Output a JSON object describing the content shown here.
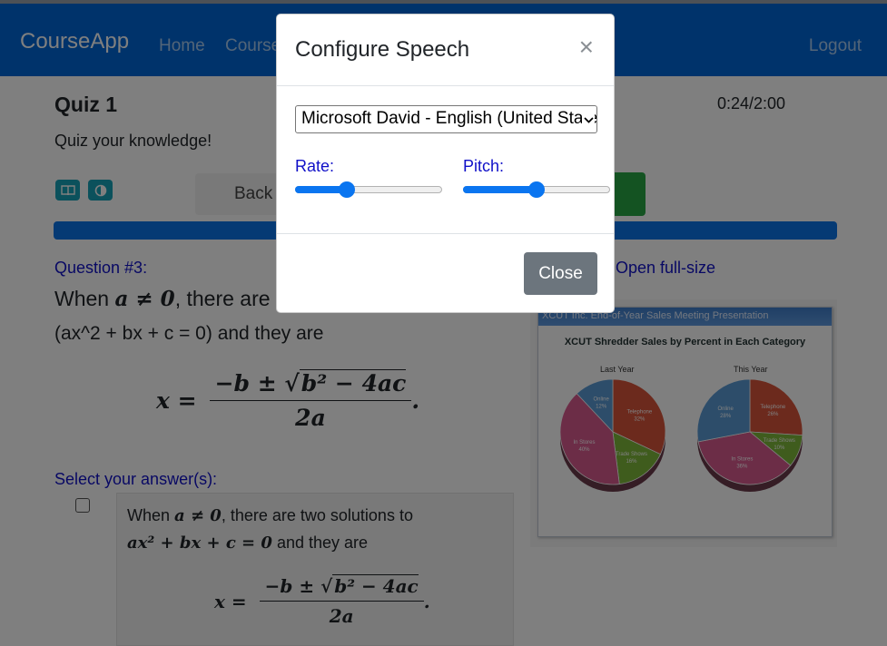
{
  "navbar": {
    "brand": "CourseApp",
    "home": "Home",
    "courses": "Courses",
    "logout": "Logout",
    "color": "#0067d6"
  },
  "quiz": {
    "title": "Quiz 1",
    "description": "Quiz your knowledge!",
    "timer": "0:24/2:00",
    "back_label": "Back",
    "progress_percent": 100
  },
  "question": {
    "number": "Question #3:",
    "line1_prefix": "When ",
    "line1_math": "a ≠ 0",
    "line1_suffix": ", there are two solutions to",
    "line2": "(ax^2 + bx + c = 0) and they are",
    "formula_lhs": "x =",
    "formula_num": "−b ± √",
    "formula_rad": "b² − 4ac",
    "formula_den": "2a",
    "formula_end": ".",
    "open_full_size": "Open full-size"
  },
  "answers": {
    "label": "Select your answer(s):",
    "option1": {
      "prefix": "When ",
      "math1": "a ≠ 0",
      "mid": ", there are two solutions to",
      "math2": "ax² + bx + c = 0",
      "suffix": " and they are",
      "formula_lhs": "x =",
      "formula_num": "−b ± √",
      "formula_rad": "b² − 4ac",
      "formula_den": "2a",
      "formula_end": ".",
      "checked": false
    }
  },
  "image": {
    "header": "XCUT Inc. End-of-Year Sales Meeting Presentation",
    "title": "XCUT Shredder Sales by Percent in Each Category",
    "pie_labels": [
      "Last Year",
      "This Year"
    ]
  },
  "chart_data": [
    {
      "type": "pie",
      "title": "Last Year",
      "categories": [
        "Telephone",
        "Trade Shows",
        "In Stores",
        "Online"
      ],
      "values": [
        32,
        16,
        40,
        12
      ],
      "colors": [
        "#d8553a",
        "#7fb83a",
        "#d85a8f",
        "#5b9bd5"
      ]
    },
    {
      "type": "pie",
      "title": "This Year",
      "categories": [
        "Telephone",
        "Trade Shows",
        "In Stores",
        "Online"
      ],
      "values": [
        26,
        10,
        36,
        28
      ],
      "colors": [
        "#d8553a",
        "#7fb83a",
        "#d85a8f",
        "#5b9bd5"
      ]
    }
  ],
  "modal": {
    "title": "Configure Speech",
    "close_symbol": "×",
    "voice": "Microsoft David - English (United States)",
    "rate_label": "Rate:",
    "pitch_label": "Pitch:",
    "rate_fraction": 0.35,
    "pitch_fraction": 0.5,
    "close_button": "Close"
  }
}
